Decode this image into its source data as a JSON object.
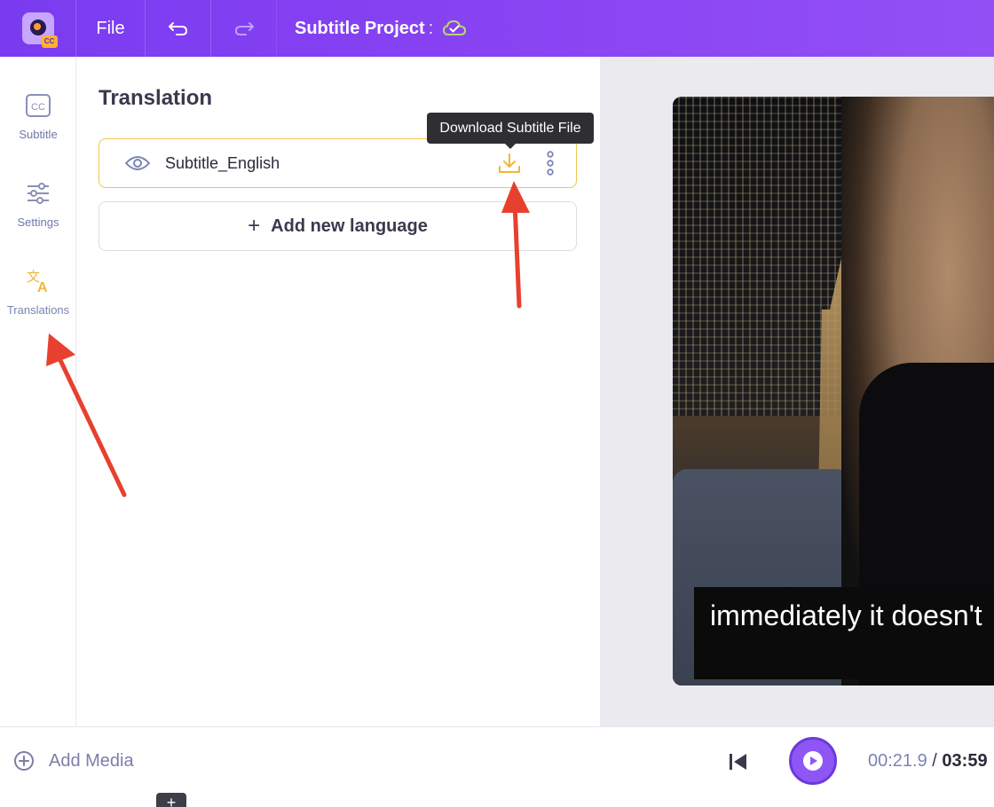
{
  "topbar": {
    "file_label": "File",
    "project_title": "Subtitle Project",
    "project_colon": ":"
  },
  "rail": {
    "items": [
      {
        "label": "Subtitle",
        "icon": "cc-icon"
      },
      {
        "label": "Settings",
        "icon": "sliders-icon"
      },
      {
        "label": "Translations",
        "icon": "translate-icon"
      }
    ]
  },
  "panel": {
    "title": "Translation",
    "languages": [
      {
        "name": "Subtitle_English"
      }
    ],
    "add_language_label": "Add new language",
    "tooltip": "Download Subtitle File"
  },
  "preview": {
    "caption_text": "immediately it doesn't"
  },
  "bottombar": {
    "add_media_label": "Add Media",
    "current_time": "00:21.9",
    "time_separator": "/",
    "total_time": "03:59"
  },
  "colors": {
    "accent": "#8b45f3",
    "active_border": "#f4c34a",
    "annotation_arrow": "#e8402f"
  }
}
